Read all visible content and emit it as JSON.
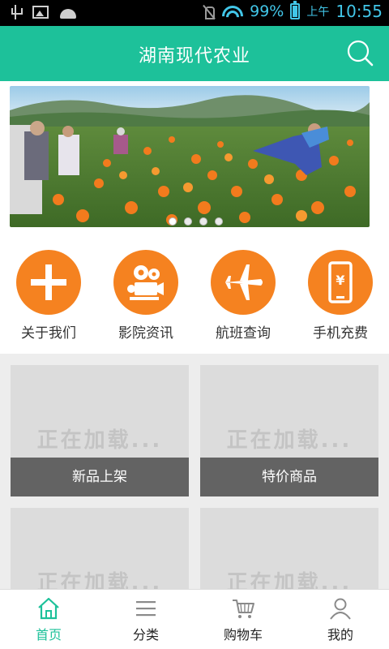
{
  "status_bar": {
    "battery_percent": "99%",
    "ampm": "上午",
    "time": "10:55"
  },
  "header": {
    "title": "湖南现代农业",
    "search_icon": "search-icon",
    "color": "#1dc19a"
  },
  "banner": {
    "page_count": 4,
    "active_index": 0
  },
  "quick_menu": [
    {
      "label": "关于我们",
      "icon": "plus-icon"
    },
    {
      "label": "影院资讯",
      "icon": "film-projector-icon"
    },
    {
      "label": "航班查询",
      "icon": "airplane-icon"
    },
    {
      "label": "手机充费",
      "icon": "phone-yuan-icon"
    }
  ],
  "accent_color": "#f58220",
  "products": [
    {
      "loading": "正在加载...",
      "label": "新品上架"
    },
    {
      "loading": "正在加载...",
      "label": "特价商品"
    },
    {
      "loading": "正在加载...",
      "label": ""
    },
    {
      "loading": "正在加载...",
      "label": ""
    }
  ],
  "bottom_nav": [
    {
      "label": "首页",
      "icon": "home-icon",
      "active": true
    },
    {
      "label": "分类",
      "icon": "list-icon",
      "active": false
    },
    {
      "label": "购物车",
      "icon": "cart-icon",
      "active": false
    },
    {
      "label": "我的",
      "icon": "user-icon",
      "active": false
    }
  ]
}
